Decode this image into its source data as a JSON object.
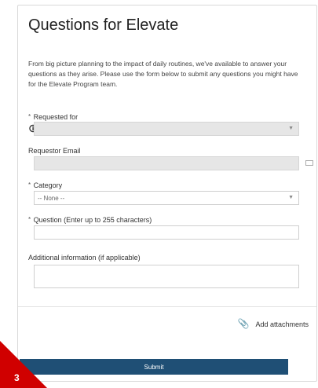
{
  "form": {
    "title": "Questions for Elevate",
    "intro": "From big picture planning to the impact of daily routines, we've available to answer your questions as they arise. Please use the form below to submit any questions you might have for the Elevate Program team.",
    "requested_for_label": "Requested for",
    "requestor_email_label": "Requestor Email",
    "category_label": "Category",
    "category_value": "-- None --",
    "question_label": "Question (Enter up to 255 characters)",
    "additional_label": "Additional information (if applicable)",
    "required_marker": "*"
  },
  "footer": {
    "attachments_label": "Add attachments",
    "submit_label": "Submit"
  },
  "overlay": {
    "corner_text": "3"
  }
}
